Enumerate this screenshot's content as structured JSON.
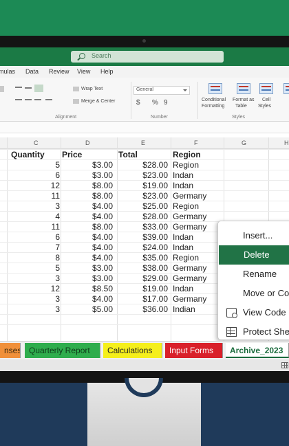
{
  "search": {
    "placeholder": "Search"
  },
  "menu": [
    "mulas",
    "Data",
    "Review",
    "View",
    "Help"
  ],
  "ribbon": {
    "wrap_text": "Wrap Text",
    "merge_center": "Merge & Center",
    "alignment": "Alignment",
    "number_format": "General",
    "currency": "$",
    "percent": "%",
    "comma": "9",
    "number": "Number",
    "conditional_formatting": [
      "Conditional",
      "Formatting"
    ],
    "format_as_table": [
      "Format as",
      "Table"
    ],
    "cell_styles": [
      "Cell",
      "Styles"
    ],
    "styles": "Styles"
  },
  "grid": {
    "columns": [
      "C",
      "D",
      "E",
      "F",
      "G",
      "H"
    ],
    "headers": [
      "Quantity",
      "Price",
      "Total",
      "Region"
    ],
    "rows": [
      [
        "5",
        "$3.00",
        "$28.00",
        "Region"
      ],
      [
        "6",
        "$3.00",
        "$23.00",
        "Indan"
      ],
      [
        "12",
        "$8.00",
        "$19.00",
        "Indan"
      ],
      [
        "11",
        "$8.00",
        "$23.00",
        "Germany"
      ],
      [
        "3",
        "$4.00",
        "$25.00",
        "Region"
      ],
      [
        "4",
        "$4.00",
        "$28.00",
        "Germany"
      ],
      [
        "11",
        "$8.00",
        "$33.00",
        "Germany"
      ],
      [
        "6",
        "$4.00",
        "$39.00",
        "Indan"
      ],
      [
        "7",
        "$4.00",
        "$24.00",
        "Indan"
      ],
      [
        "8",
        "$4.00",
        "$35.00",
        "Region"
      ],
      [
        "5",
        "$3.00",
        "$38.00",
        "Germany"
      ],
      [
        "3",
        "$3.00",
        "$29.00",
        "Germany"
      ],
      [
        "12",
        "$8.50",
        "$19.00",
        "Indan"
      ],
      [
        "3",
        "$4.00",
        "$17.00",
        "Germany"
      ],
      [
        "3",
        "$5.00",
        "$36.00",
        "Indian"
      ]
    ]
  },
  "sheet_tabs": [
    {
      "label": "nses",
      "bg": "#f0903a",
      "fg": "#3a2a10"
    },
    {
      "label": "Quarterly Report",
      "bg": "#2fad4d",
      "fg": "#0f3a1a"
    },
    {
      "label": "Calculations",
      "bg": "#f5ef1c",
      "fg": "#222222"
    },
    {
      "label": "Input Forms",
      "bg": "#d9202a",
      "fg": "#ffffff"
    },
    {
      "label": "Archive_2023",
      "bg": "#ffffff",
      "fg": "#1a6b3c"
    }
  ],
  "context_menu": {
    "items": [
      "Insert...",
      "Delete",
      "Rename",
      "Move or Co",
      "View Code",
      "Protect She"
    ],
    "active": "Delete",
    "icons": [
      "view-code-icon",
      "protect-sheet-icon"
    ]
  },
  "colors": {
    "accent": "#217346",
    "titlebar": "#1b7a45"
  }
}
